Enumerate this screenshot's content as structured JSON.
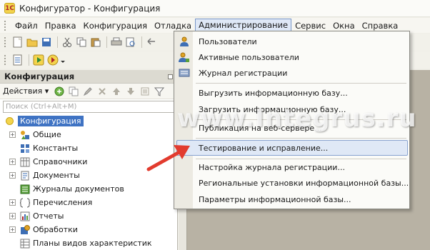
{
  "window": {
    "title": "Конфигуратор - Конфигурация"
  },
  "menubar": {
    "items": [
      "Файл",
      "Правка",
      "Конфигурация",
      "Отладка",
      "Администрирование",
      "Сервис",
      "Окна",
      "Справка"
    ]
  },
  "panel": {
    "title": "Конфигурация",
    "actions_label": "Действия",
    "search_placeholder": "Поиск (Ctrl+Alt+M)"
  },
  "tree": {
    "root": "Конфигурация",
    "items": [
      {
        "label": "Общие",
        "icon": "shapes-icon"
      },
      {
        "label": "Константы",
        "icon": "constants-icon"
      },
      {
        "label": "Справочники",
        "icon": "catalogs-icon"
      },
      {
        "label": "Документы",
        "icon": "documents-icon"
      },
      {
        "label": "Журналы документов",
        "icon": "journals-icon"
      },
      {
        "label": "Перечисления",
        "icon": "enumerations-icon"
      },
      {
        "label": "Отчеты",
        "icon": "reports-icon"
      },
      {
        "label": "Обработки",
        "icon": "processing-icon"
      },
      {
        "label": "Планы видов характеристик",
        "icon": "characteristics-icon"
      }
    ]
  },
  "admin_menu": {
    "items": [
      {
        "label": "Пользователи",
        "icon": "user-icon"
      },
      {
        "label": "Активные пользователи",
        "icon": "active-users-icon"
      },
      {
        "label": "Журнал регистрации",
        "icon": "event-log-icon"
      },
      {
        "label": "Выгрузить информационную базу..."
      },
      {
        "label": "Загрузить информационную базу..."
      },
      {
        "label": "Публикация на веб-сервере..."
      },
      {
        "label": "Тестирование и исправление..."
      },
      {
        "label": "Настройка журнала регистрации..."
      },
      {
        "label": "Региональные установки информационной базы..."
      },
      {
        "label": "Параметры информационной базы..."
      }
    ]
  },
  "watermark": "www.Integrus.ru",
  "colors": {
    "accent": "#3f73c3",
    "highlight": "#dfe8f6",
    "arrow": "#e23b2e"
  }
}
